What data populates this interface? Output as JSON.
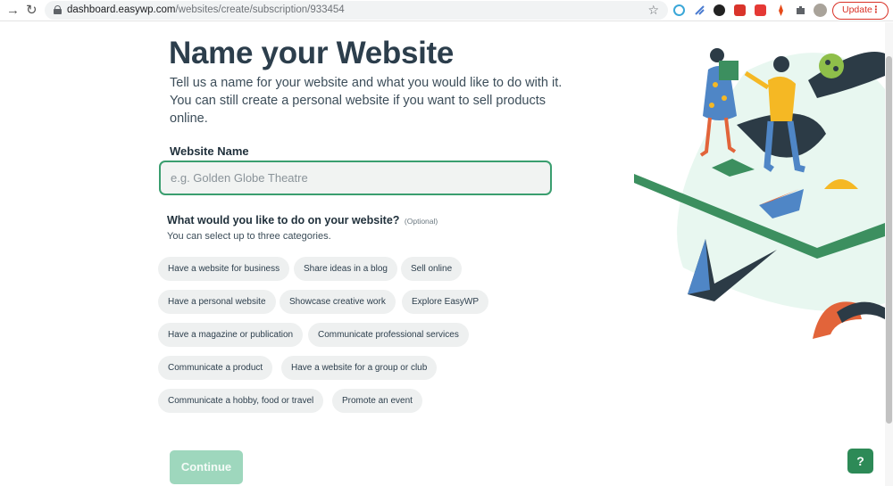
{
  "browser": {
    "url_host": "dashboard.easywp.com",
    "url_path": "/websites/create/subscription/933454",
    "update_label": "Update",
    "icons": [
      "back-arrow-icon",
      "reload-icon",
      "lock-icon",
      "bookmark-star-icon",
      "extension-icon",
      "profile-avatar-icon",
      "menu-dots-icon"
    ]
  },
  "page": {
    "title": "Name your Website",
    "intro": "Tell us a name for your website and what you would like to do with it. You can still create a personal website if you want to sell products online.",
    "name_field": {
      "label": "Website Name",
      "placeholder": "e.g. Golden Globe Theatre",
      "value": ""
    },
    "categories": {
      "question": "What would you like to do on your website?",
      "optional": "(Optional)",
      "hint": "You can select up to three categories.",
      "options": [
        "Have a website for business",
        "Share ideas in a blog",
        "Sell online",
        "Have a personal website",
        "Showcase creative work",
        "Explore EasyWP",
        "Have a magazine or publication",
        "Communicate professional services",
        "Communicate a product",
        "Have a website for a group or club",
        "Communicate a hobby, food or travel",
        "Promote an event"
      ]
    },
    "continue_label": "Continue",
    "help_label": "?"
  },
  "colors": {
    "heading": "#2c3e4c",
    "accent_green": "#3a9e6f",
    "continue_disabled": "#9ed7bd",
    "help_button": "#2d8a57",
    "update_red": "#d93025"
  }
}
